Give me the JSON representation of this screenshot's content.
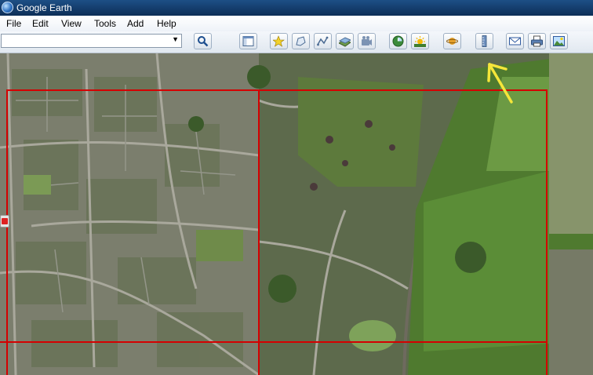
{
  "window": {
    "title": "Google Earth"
  },
  "menu": [
    "File",
    "Edit",
    "View",
    "Tools",
    "Add",
    "Help"
  ],
  "search": {
    "value": "",
    "placeholder": ""
  },
  "toolbar": {
    "icons": [
      "search-icon",
      "sidebar-icon",
      "placemark-icon",
      "polygon-icon",
      "path-icon",
      "image-overlay-icon",
      "record-tour-icon",
      "historical-imagery-icon",
      "sunlight-icon",
      "planets-icon",
      "ruler-icon",
      "email-icon",
      "print-icon",
      "save-image-icon"
    ]
  },
  "annotation": {
    "color": "#f5e63a",
    "points_to": "ruler-icon"
  },
  "overlay": {
    "grid_color": "#d40000",
    "rows": 2,
    "columns": 2
  }
}
